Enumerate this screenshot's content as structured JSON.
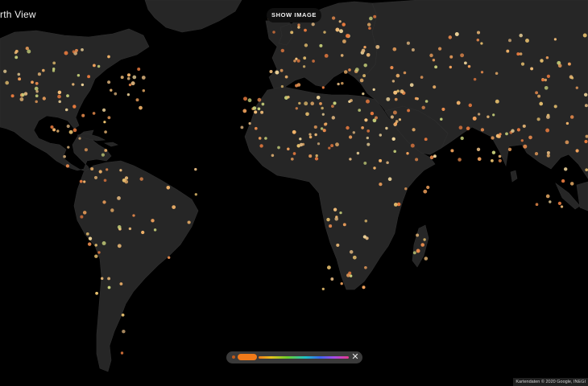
{
  "app": {
    "title": "rth View"
  },
  "toolbar": {
    "show_image_label": "SHOW IMAGE"
  },
  "filter": {
    "close_glyph": "✕",
    "active_color": "#f07a1a"
  },
  "map": {
    "attribution": "Kartendaten © 2020 Google, INEGI",
    "background_color": "#000000",
    "land_color": "#262626",
    "marker_colors": [
      "#f2a25c",
      "#e98b4c",
      "#f5c07a",
      "#f0d59a",
      "#e77a3e",
      "#d9b07a",
      "#f3b46a",
      "#e8c06e",
      "#c7d07a"
    ]
  }
}
